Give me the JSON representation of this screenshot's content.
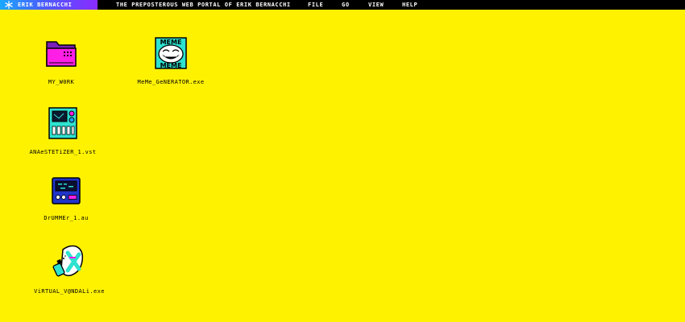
{
  "menubar": {
    "brand_name": "ERIK BERNACCHI",
    "title": "THE PREPOSTEROUS WEB PORTAL OF ERIK BERNACCHI",
    "menu": [
      "FILE",
      "GO",
      "VIEW",
      "HELP"
    ]
  },
  "desktop": {
    "background": "#fff200",
    "icons": [
      {
        "label": "MY_W0RK",
        "icon": "folder-icon"
      },
      {
        "label": "MeMe_GeNERATOR.exe",
        "icon": "troll-face-meme-icon"
      },
      {
        "label": "ANAeSTETiZER_1.vst",
        "icon": "synth-plugin-icon"
      },
      {
        "label": "DrUMMEr_1.au",
        "icon": "drum-machine-icon"
      },
      {
        "label": "ViRTUAL_V@NDALi.exe",
        "icon": "spray-can-icon"
      }
    ],
    "meme_icon_text": "MEME"
  },
  "colors": {
    "accent_blue": "#1aa8ff",
    "accent_purple": "#8b2bff",
    "magenta": "#ff1ee6",
    "cyan": "#2de2d0"
  }
}
